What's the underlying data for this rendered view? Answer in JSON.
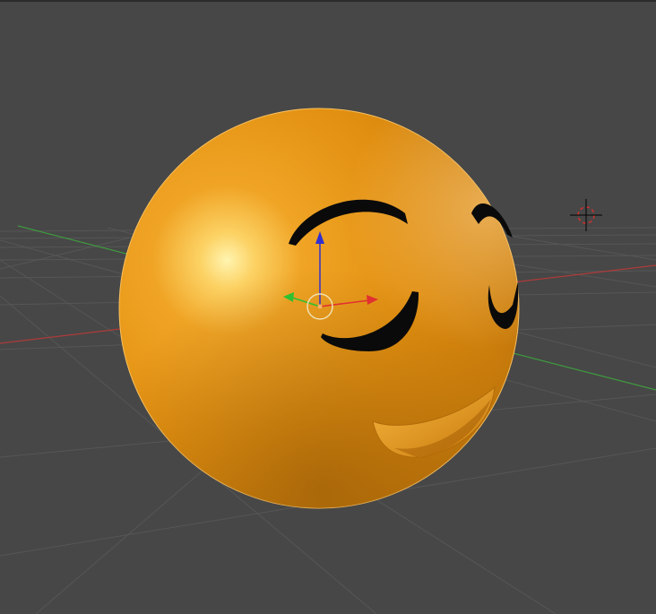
{
  "viewport": {
    "background": "#474747",
    "grid_color": "#555555",
    "x_axis_color": "#b03a3a",
    "y_axis_color": "#3f9a3f"
  },
  "object": {
    "name": "emoji-sphere",
    "base_color": "#e8950f",
    "highlight_color": "#fff2a8",
    "shadow_color": "#9c5e0a",
    "features_color": "#0a0a0a"
  },
  "gizmo": {
    "x_color": "#e03030",
    "y_color": "#30c030",
    "z_color": "#3030d0",
    "pivot_color": "#f0e0b0"
  },
  "cursor_3d": {
    "ring_color": "#d03030",
    "cross_color": "#000000"
  }
}
